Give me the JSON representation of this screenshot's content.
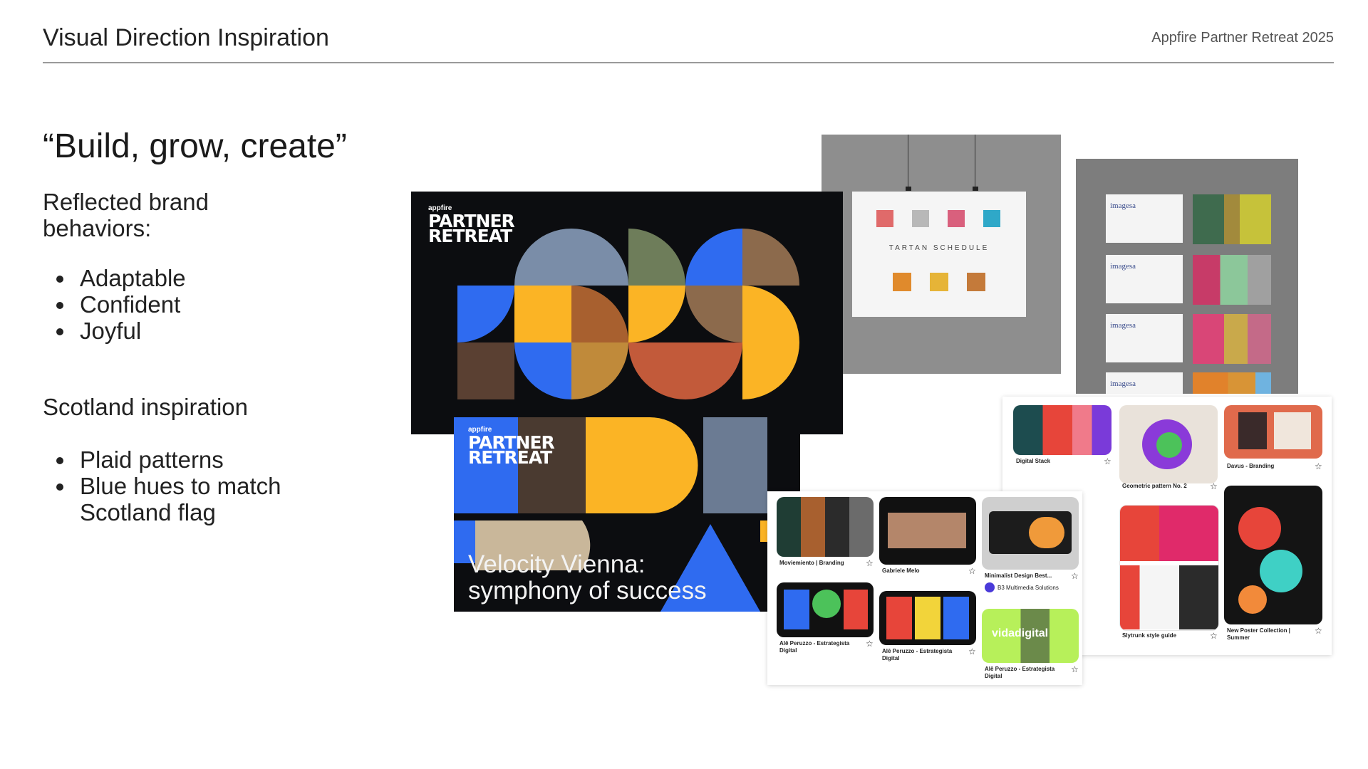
{
  "header": {
    "title": "Visual Direction Inspiration",
    "brand": "Appfire Partner Retreat 2025"
  },
  "quote": "“Build, grow, create”",
  "brand_behaviors": {
    "heading": "Reflected brand behaviors:",
    "items": [
      "Adaptable",
      "Confident",
      "Joyful"
    ]
  },
  "scotland": {
    "heading": "Scotland inspiration",
    "items": [
      "Plaid patterns",
      "Blue hues to match Scotland flag"
    ]
  },
  "banner1": {
    "appfire_tag": "appfire",
    "logo_line1": "PARTNER",
    "logo_line2": "RETREAT"
  },
  "banner2": {
    "appfire_tag": "appfire",
    "logo_line1": "PARTNER",
    "logo_line2": "RETREAT",
    "title_line1": "Velocity Vienna:",
    "title_line2": "symphony of success"
  },
  "tartan_poster": {
    "title": "TARTAN SCHEDULE"
  },
  "cards": {
    "brand": "imagesa"
  },
  "board_right": {
    "pins": [
      {
        "caption": "Digital Stack"
      },
      {
        "caption": "Geometric pattern No. 2"
      },
      {
        "caption": "Davus - Branding"
      },
      {
        "caption": "Slytrunk style guide"
      },
      {
        "caption": "New Poster Collection | Summer"
      }
    ]
  },
  "board_left": {
    "pins": [
      {
        "caption": "Moviemiento | Branding"
      },
      {
        "caption": "Gabriele Melo"
      },
      {
        "caption": "Minimalist Design Best...",
        "sub": "B3 Multimedia Solutions"
      },
      {
        "caption": "Alê Peruzzo - Estrategista Digital"
      },
      {
        "caption": "Alê Peruzzo - Estrategista Digital"
      },
      {
        "caption": "Alê Peruzzo - Estrategista Digital"
      }
    ],
    "vida_word": "vida",
    "vida_word2": "digital"
  },
  "colors": {
    "blue": "#2f6bf0",
    "yellow": "#fbb425",
    "dark": "#0c0d10"
  }
}
